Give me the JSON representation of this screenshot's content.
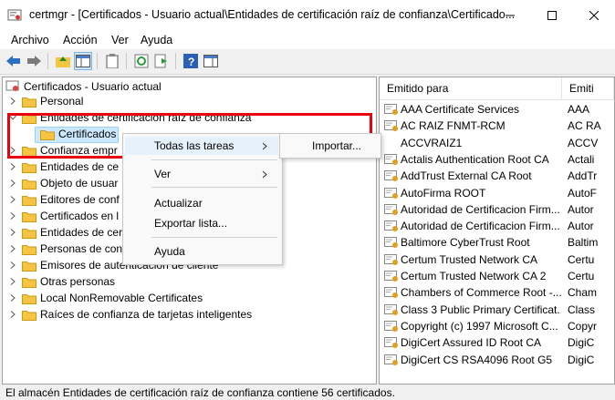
{
  "window": {
    "app_name": "certmgr",
    "title": "certmgr - [Certificados - Usuario actual\\Entidades de certificación raíz de confianza\\Certificado..."
  },
  "menu": [
    "Archivo",
    "Acción",
    "Ver",
    "Ayuda"
  ],
  "tree": {
    "root": "Certificados - Usuario actual",
    "items": [
      "Personal",
      "Entidades de certificación raíz de confianza",
      "Certificados",
      "Confianza empr",
      "Entidades de ce",
      "Objeto de usuar",
      "Editores de conf",
      "Certificados en l",
      "Entidades de cer",
      "Personas de con",
      "Emisores de autenticación de cliente",
      "Otras personas",
      "Local NonRemovable Certificates",
      "Raíces de confianza de tarjetas inteligentes"
    ]
  },
  "context_menu": {
    "all_tasks": "Todas las tareas",
    "view": "Ver",
    "refresh": "Actualizar",
    "export_list": "Exportar lista...",
    "help": "Ayuda"
  },
  "submenu": {
    "import": "Importar..."
  },
  "list": {
    "col_issued_to": "Emitido para",
    "col_issued_by": "Emiti",
    "rows": [
      [
        "AAA Certificate Services",
        "AAA"
      ],
      [
        "AC RAIZ FNMT-RCM",
        "AC RA"
      ],
      [
        "ACCVRAIZ1",
        "ACCV"
      ],
      [
        "Actalis Authentication Root CA",
        "Actali"
      ],
      [
        "AddTrust External CA Root",
        "AddTr"
      ],
      [
        "AutoFirma ROOT",
        "AutoF"
      ],
      [
        "Autoridad de Certificacion Firm...",
        "Autor"
      ],
      [
        "Autoridad de Certificacion Firm...",
        "Autor"
      ],
      [
        "Baltimore CyberTrust Root",
        "Baltim"
      ],
      [
        "Certum Trusted Network CA",
        "Certu"
      ],
      [
        "Certum Trusted Network CA 2",
        "Certu"
      ],
      [
        "Chambers of Commerce Root -...",
        "Cham"
      ],
      [
        "Class 3 Public Primary Certificat...",
        "Class"
      ],
      [
        "Copyright (c) 1997 Microsoft C...",
        "Copyr"
      ],
      [
        "DigiCert Assured ID Root CA",
        "DigiC"
      ],
      [
        "DigiCert CS RSA4096 Root G5",
        "DigiC"
      ]
    ]
  },
  "status": "El almacén Entidades de certificación raíz de confianza contiene 56 certificados.",
  "colors": {
    "highlight_box": "#e8000b",
    "selection": "#cce8ff",
    "folder": "#f5c542"
  }
}
